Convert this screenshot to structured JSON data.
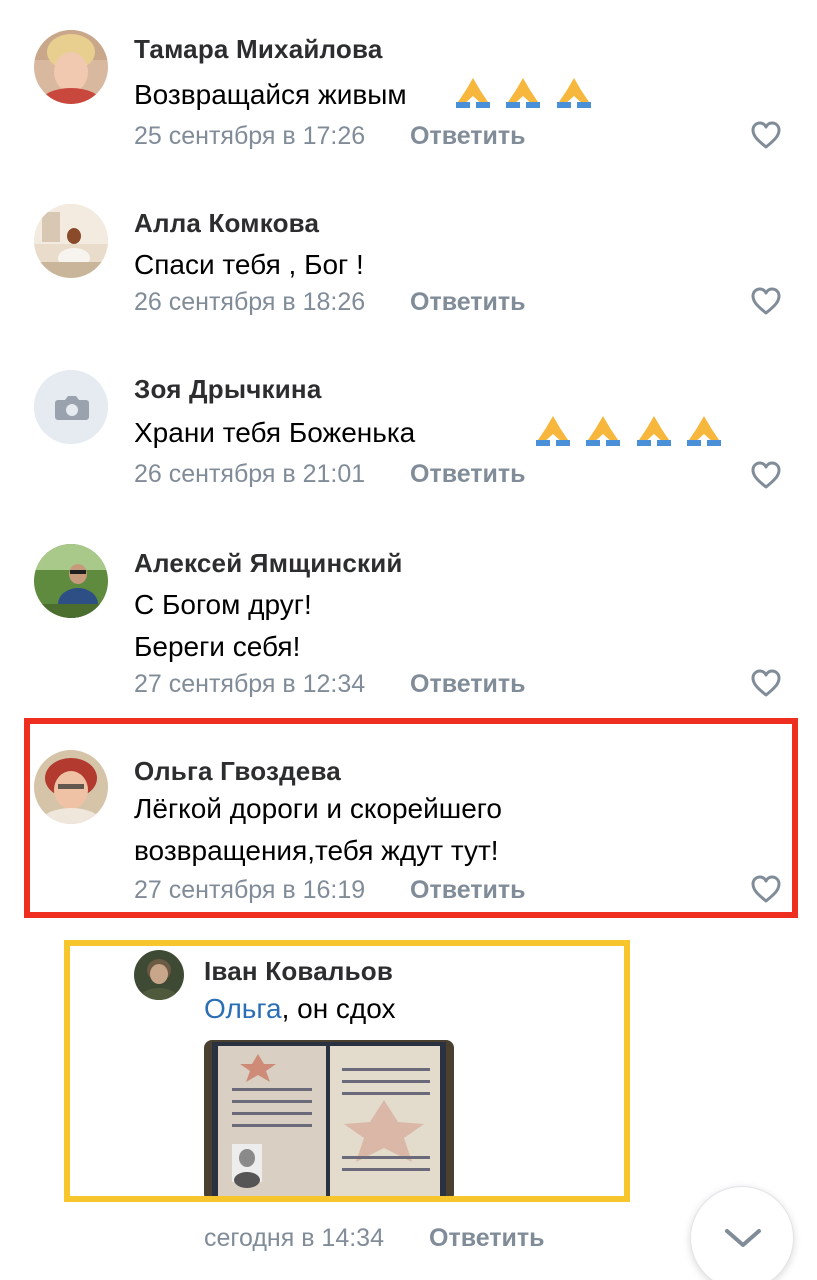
{
  "comments": [
    {
      "author": "Тамара Михайлова",
      "text_lines": [
        "Возвращайся живым"
      ],
      "emoji_count": 3,
      "date": "25 сентября в 17:26",
      "reply_label": "Ответить"
    },
    {
      "author": "Алла Комкова",
      "text_lines": [
        "Спаси тебя , Бог !"
      ],
      "emoji_count": 0,
      "date": "26 сентября в 18:26",
      "reply_label": "Ответить"
    },
    {
      "author": "Зоя Дрычкина",
      "text_lines": [
        "Храни тебя Боженька"
      ],
      "emoji_count": 4,
      "date": "26 сентября в 21:01",
      "reply_label": "Ответить"
    },
    {
      "author": "Алексей Ямщинский",
      "text_lines": [
        "С Богом друг!",
        "Береги себя!"
      ],
      "emoji_count": 0,
      "date": "27 сентября в 12:34",
      "reply_label": "Ответить"
    },
    {
      "author": "Ольга Гвоздева",
      "text_lines": [
        "Лёгкой дороги и скорейшего",
        "возвращения,тебя ждут тут!"
      ],
      "emoji_count": 0,
      "date": "27 сентября в 16:19",
      "reply_label": "Ответить"
    }
  ],
  "reply": {
    "author": "Іван Ковальов",
    "mention": "Ольга",
    "text": ", он сдох",
    "date": "сегодня в 14:34",
    "reply_label": "Ответить"
  },
  "icons": {
    "like": "heart-outline-icon",
    "emoji": "folded-hands-icon",
    "camera": "camera-icon",
    "scroll": "chevron-down-icon"
  },
  "colors": {
    "highlight_red": "#ee2e1f",
    "highlight_yellow": "#f7c52c",
    "meta_gray": "#818c99",
    "link_blue": "#2a6fb5"
  }
}
